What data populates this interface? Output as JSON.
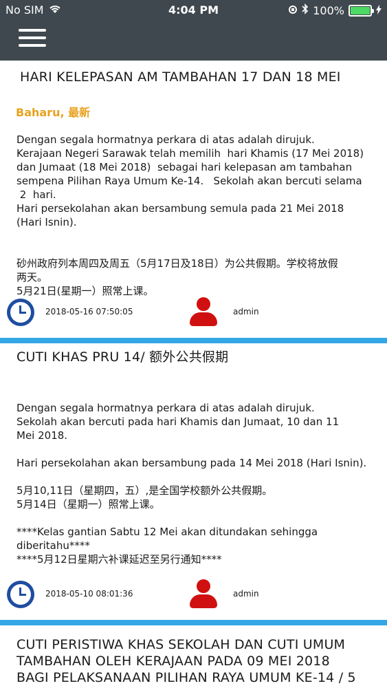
{
  "status_bar": {
    "carrier": "No SIM",
    "time": "4:04 PM",
    "battery": "100%"
  },
  "posts": [
    {
      "title": "HARI KELEPASAN AM TAMBAHAN 17 DAN 18 MEI",
      "tag": "Baharu, 最新",
      "body": "Dengan segala hormatnya perkara di atas adalah dirujuk.\nKerajaan Negeri Sarawak telah memilih  hari Khamis (17 Mei 2018)\ndan Jumaat (18 Mei 2018)  sebagai hari kelepasan am tambahan\nsempena Pilihan Raya Umum Ke-14.   Sekolah akan bercuti selama\n 2  hari.\nHari persekolahan akan bersambung semula pada 21 Mei 2018\n(Hari Isnin).\n\n\n砂州政府列本周四及周五（5月17日及18日）为公共假期。学校将放假\n两天。\n5月21日(星期一）照常上课。",
      "date": "2018-05-16 07:50:05",
      "author": "admin"
    },
    {
      "title": "CUTI KHAS  PRU 14/ 额外公共假期",
      "body": "Dengan segala hormatnya perkara di atas adalah dirujuk.\nSekolah akan bercuti pada hari Khamis dan Jumaat, 10 dan 11\nMei 2018.\n\nHari persekolahan akan bersambung pada 14 Mei 2018 (Hari Isnin).\n\n5月10,11日（星期四，五）,是全国学校额外公共假期。\n5月14日（星期一）照常上课。\n\n****Kelas gantian Sabtu 12 Mei akan ditundakan sehingga\ndiberitahu****\n****5月12日星期六补课延迟至另行通知****",
      "date": "2018-05-10 08:01:36",
      "author": "admin"
    },
    {
      "title": "CUTI PERISTIWA KHAS SEKOLAH DAN CUTI UMUM\nTAMBAHAN OLEH KERAJAAN PADA 09 MEI 2018\nBAGI PELAKSANAAN PILIHAN RAYA UMUM KE-14 / 5"
    }
  ],
  "colors": {
    "header": "#3f484f",
    "divider": "#33a7e6",
    "tag": "#e8a21f",
    "clock_icon": "#1e4da1",
    "user_icon": "#d01010"
  }
}
